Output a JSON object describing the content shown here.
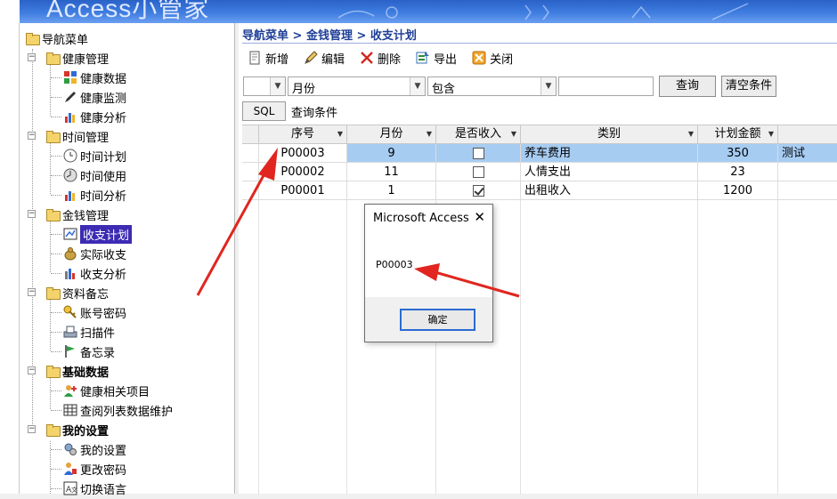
{
  "banner": {
    "title": "Access小管家"
  },
  "nav": {
    "root": "导航菜单",
    "groups": [
      {
        "label": "健康管理",
        "items": [
          "健康数据",
          "健康监测",
          "健康分析"
        ]
      },
      {
        "label": "时间管理",
        "items": [
          "时间计划",
          "时间使用",
          "时间分析"
        ]
      },
      {
        "label": "金钱管理",
        "items": [
          "收支计划",
          "实际收支",
          "收支分析"
        ]
      },
      {
        "label": "资料备忘",
        "items": [
          "账号密码",
          "扫描件",
          "备忘录"
        ]
      },
      {
        "label": "基础数据",
        "items": [
          "健康相关项目",
          "查阅列表数据维护"
        ]
      },
      {
        "label": "我的设置",
        "items": [
          "我的设置",
          "更改密码",
          "切换语言"
        ]
      }
    ],
    "selected": "收支计划"
  },
  "breadcrumb": "导航菜单 > 金钱管理 > 收支计划",
  "toolbar": {
    "new": "新增",
    "edit": "编辑",
    "delete": "删除",
    "export": "导出",
    "close": "关闭"
  },
  "filter": {
    "field": "月份",
    "operator": "包含",
    "value": "",
    "query": "查询",
    "clear": "清空条件"
  },
  "sql": {
    "button": "SQL",
    "label": "查询条件"
  },
  "grid": {
    "columns": [
      "序号",
      "月份",
      "是否收入",
      "类别",
      "计划金额"
    ],
    "rows": [
      {
        "id": "P00003",
        "month": "9",
        "income": false,
        "category": "养车费用",
        "amount": "350",
        "note": "测试"
      },
      {
        "id": "P00002",
        "month": "11",
        "income": false,
        "category": "人情支出",
        "amount": "23",
        "note": ""
      },
      {
        "id": "P00001",
        "month": "1",
        "income": true,
        "category": "出租收入",
        "amount": "1200",
        "note": ""
      }
    ]
  },
  "dialog": {
    "title": "Microsoft Access",
    "message": "P00003",
    "ok": "确定",
    "close": "✕"
  },
  "colors": {
    "banner": "#3f7de0",
    "selection": "#a7ccf2",
    "nav_selected": "#3d2bb3",
    "arrow": "#e0261f"
  }
}
